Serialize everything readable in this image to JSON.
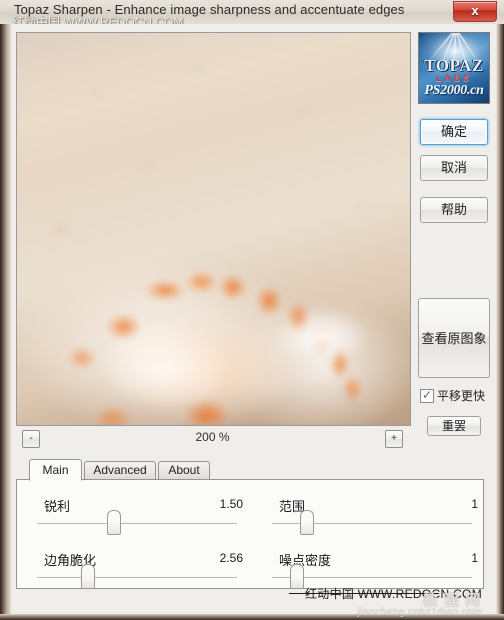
{
  "window": {
    "title": "Topaz Sharpen - Enhance image sharpness and accentuate edges",
    "close_label": "x"
  },
  "watermarks": {
    "top": "红动中国 WWW.REDOCN.COM",
    "bottom": "红动中国 WWW.REDOCN.COM",
    "ghost": "教程网",
    "ghost_sub": "jiaocheng.cnbz1dian.com"
  },
  "preview": {
    "subject": "blurred seashell on sand",
    "zoom_out_label": "-",
    "zoom_in_label": "+",
    "zoom_level": "200 %"
  },
  "logo": {
    "brand": "TOPAZ",
    "sub": "LABS",
    "watermark": "PS2000.cn"
  },
  "buttons": {
    "ok": "确定",
    "cancel": "取消",
    "help": "帮助",
    "view_original": "查看原图象",
    "reset": "重罢"
  },
  "checkbox": {
    "label": "平移更快",
    "checked": true
  },
  "tabs": [
    {
      "label": "Main",
      "active": true
    },
    {
      "label": "Advanced",
      "active": false
    },
    {
      "label": "About",
      "active": false
    }
  ],
  "sliders": [
    {
      "label": "锐利",
      "value": "1.50",
      "pos_pct": 38
    },
    {
      "label": "范围",
      "value": "1",
      "pos_pct": 17
    },
    {
      "label": "边角脆化",
      "value": "2.56",
      "pos_pct": 25
    },
    {
      "label": "噪点密度",
      "value": "1",
      "pos_pct": 12
    }
  ],
  "colors": {
    "accent": "#4f9fd2",
    "close": "#c33a2a",
    "logo_blue": "#2a6aa8",
    "logo_red": "#d83a2a"
  }
}
